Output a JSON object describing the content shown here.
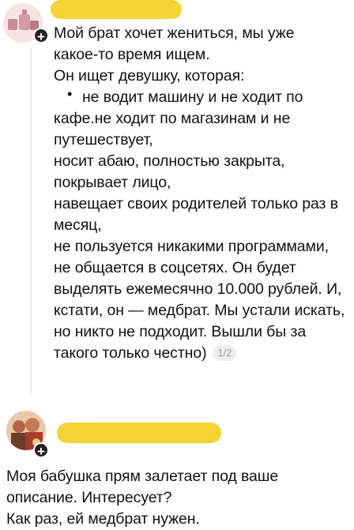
{
  "comment1": {
    "text_lines": [
      "Мой брат хочет жениться, мы уже",
      "какое-то время ищем.",
      "Он ищет девушку, которая:",
      "не водит машину и не ходит по",
      "кафе.не ходит по магазинам и не",
      "путешествует,",
      "носит абаю, полностью закрыта,",
      "покрывает лицо,",
      "навещает своих родителей только раз в",
      "месяц,",
      "не пользуется никакими программами,",
      "не общается в соцсетях. Он будет",
      "выделять ежемесячно 10.000 рублей. И,",
      "кстати, он — медбрат. Мы устали искать,",
      "но никто не подходит. Вышли бы за",
      "такого только честно)"
    ],
    "page_badge": "1/2",
    "bullet": "•",
    "plus": "+"
  },
  "comment2": {
    "text_lines": [
      "Моя бабушка прям залетает под ваше",
      "описание. Интересует?",
      "Как раз, ей медбрат нужен."
    ],
    "plus": "+"
  },
  "colors": {
    "redaction": "#f6d334",
    "text": "#111111",
    "badge_bg": "#eeeeee"
  }
}
